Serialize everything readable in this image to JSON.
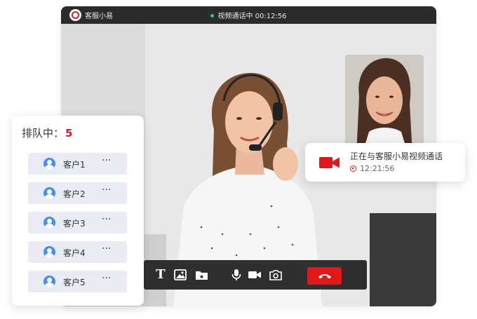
{
  "window": {
    "app_name": "客服小易",
    "status_text": "视频通话中 00:12:56"
  },
  "toolbar": {
    "buttons": [
      {
        "icon": "text-icon",
        "label": "T"
      },
      {
        "icon": "image-icon"
      },
      {
        "icon": "folder-star-icon"
      },
      {
        "icon": "microphone-icon"
      },
      {
        "icon": "video-camera-icon"
      },
      {
        "icon": "camera-icon"
      },
      {
        "icon": "hang-up-icon"
      }
    ]
  },
  "queue": {
    "label": "排队中：",
    "count": "5",
    "items": [
      {
        "name": "客户1",
        "more": "···"
      },
      {
        "name": "客户2",
        "more": "···"
      },
      {
        "name": "客户3",
        "more": "···"
      },
      {
        "name": "客户4",
        "more": "···"
      },
      {
        "name": "客户5",
        "more": "···"
      }
    ]
  },
  "call_card": {
    "message": "正在与客服小易视频通话",
    "timer": "12:21:56"
  },
  "colors": {
    "accent": "#e0181e",
    "titlebar": "#2b2b2d",
    "toolbar": "#2f2f31",
    "queue_item_bg": "#e9ecf4",
    "avatar": "#4a90e2",
    "status_dot": "#2ecc71"
  }
}
